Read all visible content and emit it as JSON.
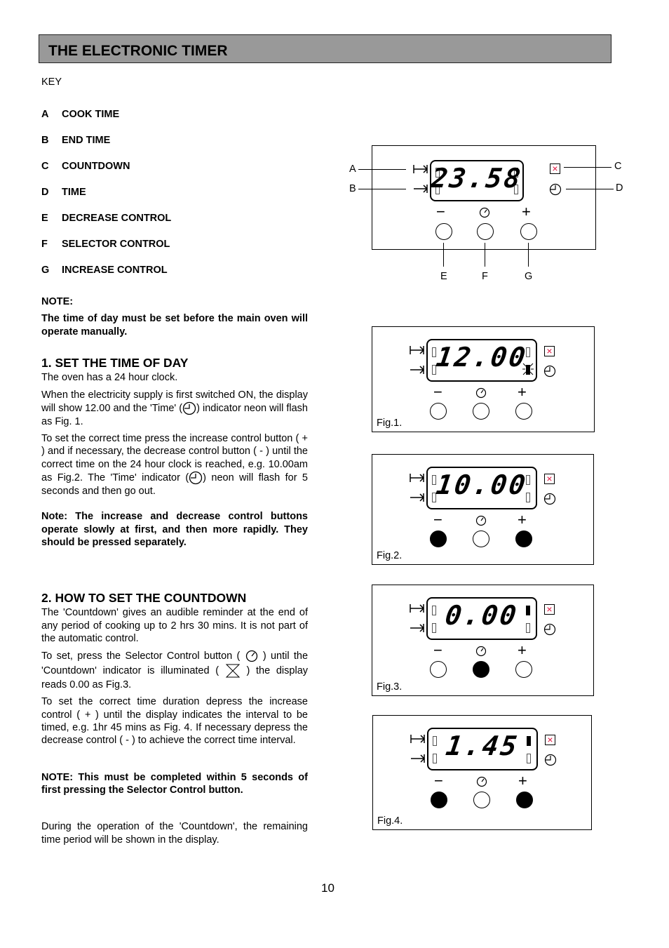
{
  "header": {
    "title": "THE ELECTRONIC TIMER"
  },
  "key": {
    "label": "KEY",
    "items": [
      {
        "letter": "A",
        "text": "COOK TIME"
      },
      {
        "letter": "B",
        "text": "END TIME"
      },
      {
        "letter": "C",
        "text": "COUNTDOWN"
      },
      {
        "letter": "D",
        "text": "TIME"
      },
      {
        "letter": "E",
        "text": "DECREASE CONTROL"
      },
      {
        "letter": "F",
        "text": "SELECTOR CONTROL"
      },
      {
        "letter": "G",
        "text": "INCREASE CONTROL"
      }
    ]
  },
  "note1": {
    "heading": "NOTE:",
    "text": "The time of day must be set before the main oven will operate manually."
  },
  "section1": {
    "heading": "1.  SET THE TIME OF DAY",
    "p1": "The oven has a 24 hour clock.",
    "p2a": "When the electricity supply is first switched ON, the display will show 12.00 and the 'Time' (",
    "p2b": ") indicator neon will flash as Fig. 1.",
    "p3a": "To set the correct time press the increase control button ( + ) and if necessary, the decrease control button ( - ) until the correct time on the 24 hour clock is reached, e.g. 10.00am as Fig.2.  The 'Time' indicator (",
    "p3b": ") neon will flash for 5 seconds and then go out.",
    "note": "Note: The increase and decrease control buttons operate slowly at first, and then more rapidly. They should be pressed separately."
  },
  "section2": {
    "heading": "2.  HOW TO SET THE COUNTDOWN",
    "p1": "The 'Countdown' gives an audible reminder at the end of any period of cooking up to 2 hrs 30 mins.  It is not part of the automatic control.",
    "p2a": "To set, press the Selector Control button (",
    "p2b": ") until the 'Countdown' indicator is illuminated (",
    "p2c": ") the display reads 0.00 as Fig.3.",
    "p3": "To set the correct time duration depress the increase control ( + ) until the display indicates the interval to be timed, e.g. 1hr 45 mins as Fig. 4.  If necessary depress the decrease control ( - ) to achieve the correct time interval.",
    "note": "NOTE:  This must be completed within 5 seconds of first pressing the Selector Control button.",
    "p4": "During the operation of the 'Countdown', the remaining time period will be shown in the display."
  },
  "diagram": {
    "display": "23.58",
    "labels": {
      "a": "A",
      "b": "B",
      "c": "C",
      "d": "D",
      "e": "E",
      "f": "F",
      "g": "G"
    },
    "minus": "−",
    "plus": "+"
  },
  "figures": [
    {
      "caption": "Fig.1.",
      "display": "12.00",
      "pressed": [
        false,
        false,
        false
      ]
    },
    {
      "caption": "Fig.2.",
      "display": "10.00",
      "pressed": [
        true,
        false,
        true
      ]
    },
    {
      "caption": "Fig.3.",
      "display": "0.00",
      "pressed": [
        false,
        true,
        false
      ]
    },
    {
      "caption": "Fig.4.",
      "display": "1.45",
      "pressed": [
        true,
        false,
        true
      ]
    }
  ],
  "page_number": "10"
}
